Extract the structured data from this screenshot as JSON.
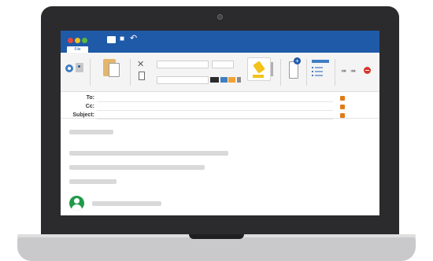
{
  "window": {
    "file_tab_label": "File",
    "title_icons": [
      "mail-icon",
      "save-icon",
      "undo-icon"
    ]
  },
  "header": {
    "to_label": "To:",
    "cc_label": "Cc:",
    "subject_label": "Subject:"
  },
  "colors": {
    "titlebar": "#1f5aa8",
    "accent_orange": "#e07b1a",
    "avatar_green": "#1f9a48",
    "highlighter": "#f4c21a",
    "close_red": "#d7342a"
  }
}
